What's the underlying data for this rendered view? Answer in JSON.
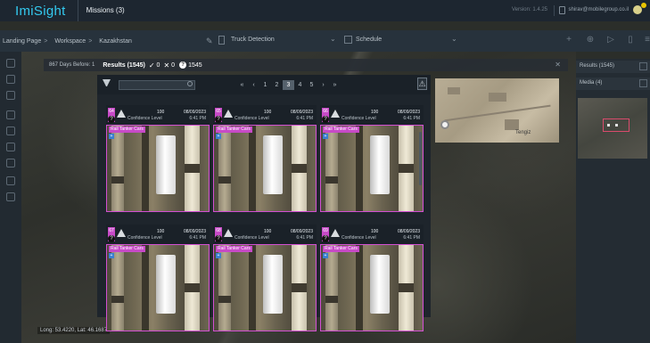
{
  "app": {
    "brand": "ImiSight",
    "mission_tab": "Missions (3)",
    "version": "Version: 1.4.25",
    "user_email": "shirav@mobilegroup.co.il"
  },
  "breadcrumb": {
    "items": [
      "Landing Page",
      "Workspace",
      "Kazakhstan"
    ],
    "detection_dropdown": "Truck Detection",
    "schedule_dropdown": "Schedule"
  },
  "results_bar": {
    "days_label": "867 Days Before: 1",
    "title": "Results (1545)",
    "approved": "0",
    "rejected": "0",
    "unknown": "1545"
  },
  "right_panel": {
    "results_label": "Results (1545)",
    "media_label": "Media (4)"
  },
  "pager": {
    "pages": [
      "1",
      "2",
      "3",
      "4",
      "5"
    ],
    "current": "3"
  },
  "cards": [
    {
      "id": "64",
      "confidence": "100",
      "confidence_label": "Confidence Level",
      "date": "08/09/2023",
      "time": "6:41 PM",
      "tag": "Rail Tanker Cars"
    },
    {
      "id": "65",
      "confidence": "100",
      "confidence_label": "Confidence Level",
      "date": "08/09/2023",
      "time": "6:41 PM",
      "tag": "Rail Tanker Cars"
    },
    {
      "id": "66",
      "confidence": "100",
      "confidence_label": "Confidence Level",
      "date": "08/09/2023",
      "time": "6:41 PM",
      "tag": "Rail Tanker Cars"
    },
    {
      "id": "67",
      "confidence": "100",
      "confidence_label": "Confidence Level",
      "date": "08/09/2023",
      "time": "6:41 PM",
      "tag": "Rail Tanker Cars"
    },
    {
      "id": "68",
      "confidence": "100",
      "confidence_label": "Confidence Level",
      "date": "08/09/2023",
      "time": "6:41 PM",
      "tag": "Rail Tanker Cars"
    },
    {
      "id": "69",
      "confidence": "100",
      "confidence_label": "Confidence Level",
      "date": "08/09/2023",
      "time": "6:41 PM",
      "tag": "Rail Tanker Cars"
    }
  ],
  "minimap": {
    "label": "Tengiz"
  },
  "map": {
    "coords": "Long: 53.4220, Lat: 46.1687"
  },
  "colors": {
    "accent": "#33c9ef",
    "detection": "#c74ac7"
  },
  "icons": [
    "filter-icon",
    "search-icon",
    "warning-icon",
    "lock-icon",
    "bell-icon",
    "calendar-icon",
    "close-icon",
    "location-pin-icon"
  ]
}
